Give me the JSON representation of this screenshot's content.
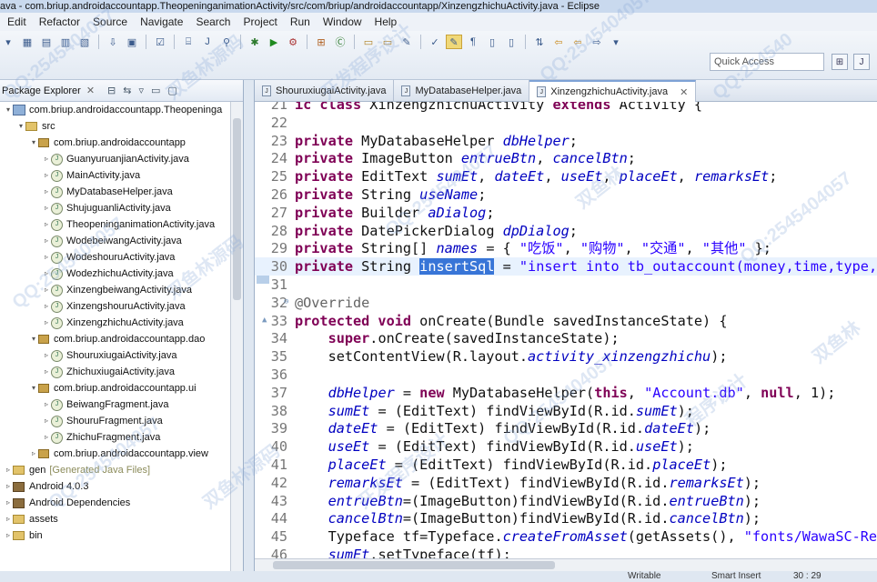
{
  "window": {
    "title": "ava - com.briup.androidaccountapp.TheopeninganimationActivity/src/com/briup/androidaccountapp/XinzengzhichuActivity.java - Eclipse"
  },
  "menu": [
    "Edit",
    "Refactor",
    "Source",
    "Navigate",
    "Search",
    "Project",
    "Run",
    "Window",
    "Help"
  ],
  "toolbar": {
    "quick_access": "Quick Access"
  },
  "package_explorer": {
    "title": "Package Explorer",
    "items": [
      {
        "label": "com.briup.androidaccountapp.Theopeninga",
        "kind": "project",
        "indent": 0,
        "arrow": "▾"
      },
      {
        "label": "src",
        "kind": "folder",
        "indent": 1,
        "arrow": "▾"
      },
      {
        "label": "com.briup.androidaccountapp",
        "kind": "package",
        "indent": 2,
        "arrow": "▾"
      },
      {
        "label": "GuanyuruanjianActivity.java",
        "kind": "java",
        "indent": 3,
        "arrow": "▹"
      },
      {
        "label": "MainActivity.java",
        "kind": "java",
        "indent": 3,
        "arrow": "▹"
      },
      {
        "label": "MyDatabaseHelper.java",
        "kind": "java",
        "indent": 3,
        "arrow": "▹"
      },
      {
        "label": "ShujuguanliActivity.java",
        "kind": "java",
        "indent": 3,
        "arrow": "▹"
      },
      {
        "label": "TheopeninganimationActivity.java",
        "kind": "java",
        "indent": 3,
        "arrow": "▹"
      },
      {
        "label": "WodebeiwangActivity.java",
        "kind": "java",
        "indent": 3,
        "arrow": "▹"
      },
      {
        "label": "WodeshouruActivity.java",
        "kind": "java",
        "indent": 3,
        "arrow": "▹"
      },
      {
        "label": "WodezhichuActivity.java",
        "kind": "java",
        "indent": 3,
        "arrow": "▹"
      },
      {
        "label": "XinzengbeiwangActivity.java",
        "kind": "java",
        "indent": 3,
        "arrow": "▹"
      },
      {
        "label": "XinzengshouruActivity.java",
        "kind": "java",
        "indent": 3,
        "arrow": "▹"
      },
      {
        "label": "XinzengzhichuActivity.java",
        "kind": "java",
        "indent": 3,
        "arrow": "▹"
      },
      {
        "label": "com.briup.androidaccountapp.dao",
        "kind": "package",
        "indent": 2,
        "arrow": "▾"
      },
      {
        "label": "ShouruxiugaiActivity.java",
        "kind": "java",
        "indent": 3,
        "arrow": "▹"
      },
      {
        "label": "ZhichuxiugaiActivity.java",
        "kind": "java",
        "indent": 3,
        "arrow": "▹"
      },
      {
        "label": "com.briup.androidaccountapp.ui",
        "kind": "package",
        "indent": 2,
        "arrow": "▾"
      },
      {
        "label": "BeiwangFragment.java",
        "kind": "java",
        "indent": 3,
        "arrow": "▹"
      },
      {
        "label": "ShouruFragment.java",
        "kind": "java",
        "indent": 3,
        "arrow": "▹"
      },
      {
        "label": "ZhichuFragment.java",
        "kind": "java",
        "indent": 3,
        "arrow": "▹"
      },
      {
        "label": "com.briup.androidaccountapp.view",
        "kind": "package",
        "indent": 2,
        "arrow": "▹"
      },
      {
        "label": "gen",
        "suffix": "[Generated Java Files]",
        "kind": "folder",
        "indent": 0,
        "arrow": "▹"
      },
      {
        "label": "Android 4.0.3",
        "kind": "lib",
        "indent": 0,
        "arrow": "▹"
      },
      {
        "label": "Android Dependencies",
        "kind": "lib",
        "indent": 0,
        "arrow": "▹"
      },
      {
        "label": "assets",
        "kind": "folder",
        "indent": 0,
        "arrow": "▹"
      },
      {
        "label": "bin",
        "kind": "folder",
        "indent": 0,
        "arrow": "▹"
      }
    ]
  },
  "editor": {
    "tabs": [
      {
        "label": "ShouruxiugaiActivity.java",
        "active": false
      },
      {
        "label": "MyDatabaseHelper.java",
        "active": false
      },
      {
        "label": "XinzengzhichuActivity.java",
        "active": true
      }
    ],
    "lines": [
      {
        "n": "21",
        "html": "<span class=\"kw\">ic class</span> XinzengzhichuActivity <span class=\"kw\">extends</span> Activity {"
      },
      {
        "n": "22",
        "html": ""
      },
      {
        "n": "23",
        "html": "<span class=\"kw\">private</span> MyDatabaseHelper <span class=\"fld\">dbHelper</span>;"
      },
      {
        "n": "24",
        "html": "<span class=\"kw\">private</span> ImageButton <span class=\"fld\">entrueBtn</span>, <span class=\"fld\">cancelBtn</span>;"
      },
      {
        "n": "25",
        "html": "<span class=\"kw\">private</span> EditText <span class=\"fld\">sumEt</span>, <span class=\"fld\">dateEt</span>, <span class=\"fld\">useEt</span>, <span class=\"fld\">placeEt</span>, <span class=\"fld\">remarksEt</span>;"
      },
      {
        "n": "26",
        "html": "<span class=\"kw\">private</span> String <span class=\"fld\">useName</span>;"
      },
      {
        "n": "27",
        "html": "<span class=\"kw\">private</span> Builder <span class=\"fld\">aDialog</span>;"
      },
      {
        "n": "28",
        "html": "<span class=\"kw\">private</span> DatePickerDialog <span class=\"fld\">dpDialog</span>;"
      },
      {
        "n": "29",
        "html": "<span class=\"kw\">private</span> String[] <span class=\"fld\">names</span> = { <span class=\"str\">\"吃饭\"</span>, <span class=\"str\">\"购物\"</span>, <span class=\"str\">\"交通\"</span>, <span class=\"str\">\"其他\"</span> };"
      },
      {
        "n": "30",
        "html": "<span class=\"kw\">private</span> String <span class=\"sel\">insertSql</span> = <span class=\"str\">\"insert into tb_outaccount(money,time,type,</span>",
        "hl": true
      },
      {
        "n": "31",
        "html": ""
      },
      {
        "n": "32",
        "html": "<span class=\"ann\">@Override</span>"
      },
      {
        "n": "33",
        "html": "<span class=\"kw\">protected void</span> onCreate(Bundle savedInstanceState) {"
      },
      {
        "n": "34",
        "html": "    <span class=\"kw\">super</span>.onCreate(savedInstanceState);"
      },
      {
        "n": "35",
        "html": "    setContentView(R.layout.<span class=\"fld\">activity_xinzengzhichu</span>);"
      },
      {
        "n": "36",
        "html": ""
      },
      {
        "n": "37",
        "html": "    <span class=\"fld\">dbHelper</span> = <span class=\"kw\">new</span> MyDatabaseHelper(<span class=\"kw\">this</span>, <span class=\"str\">\"Account.db\"</span>, <span class=\"kw\">null</span>, 1);"
      },
      {
        "n": "38",
        "html": "    <span class=\"fld\">sumEt</span> = (EditText) findViewById(R.id.<span class=\"fld\">sumEt</span>);"
      },
      {
        "n": "39",
        "html": "    <span class=\"fld\">dateEt</span> = (EditText) findViewById(R.id.<span class=\"fld\">dateEt</span>);"
      },
      {
        "n": "40",
        "html": "    <span class=\"fld\">useEt</span> = (EditText) findViewById(R.id.<span class=\"fld\">useEt</span>);"
      },
      {
        "n": "41",
        "html": "    <span class=\"fld\">placeEt</span> = (EditText) findViewById(R.id.<span class=\"fld\">placeEt</span>);"
      },
      {
        "n": "42",
        "html": "    <span class=\"fld\">remarksEt</span> = (EditText) findViewById(R.id.<span class=\"fld\">remarksEt</span>);"
      },
      {
        "n": "43",
        "html": "    <span class=\"fld\">entrueBtn</span>=(ImageButton)findViewById(R.id.<span class=\"fld\">entrueBtn</span>);"
      },
      {
        "n": "44",
        "html": "    <span class=\"fld\">cancelBtn</span>=(ImageButton)findViewById(R.id.<span class=\"fld\">cancelBtn</span>);"
      },
      {
        "n": "45",
        "html": "    Typeface tf=Typeface.<span class=\"fld\">createFromAsset</span>(getAssets(), <span class=\"str\">\"fonts/WawaSC-Re</span>"
      },
      {
        "n": "46",
        "html": "    <span class=\"fld\">sumEt</span>.setTypeface(tf);"
      }
    ]
  },
  "status": {
    "writable": "Writable",
    "insert_mode": "Smart Insert",
    "position": "30 : 29"
  },
  "watermarks": [
    "QQ:2545404057",
    "双鱼林源码",
    "开发程序设计",
    "QQ:254540",
    "双鱼林",
    "程序设计"
  ]
}
